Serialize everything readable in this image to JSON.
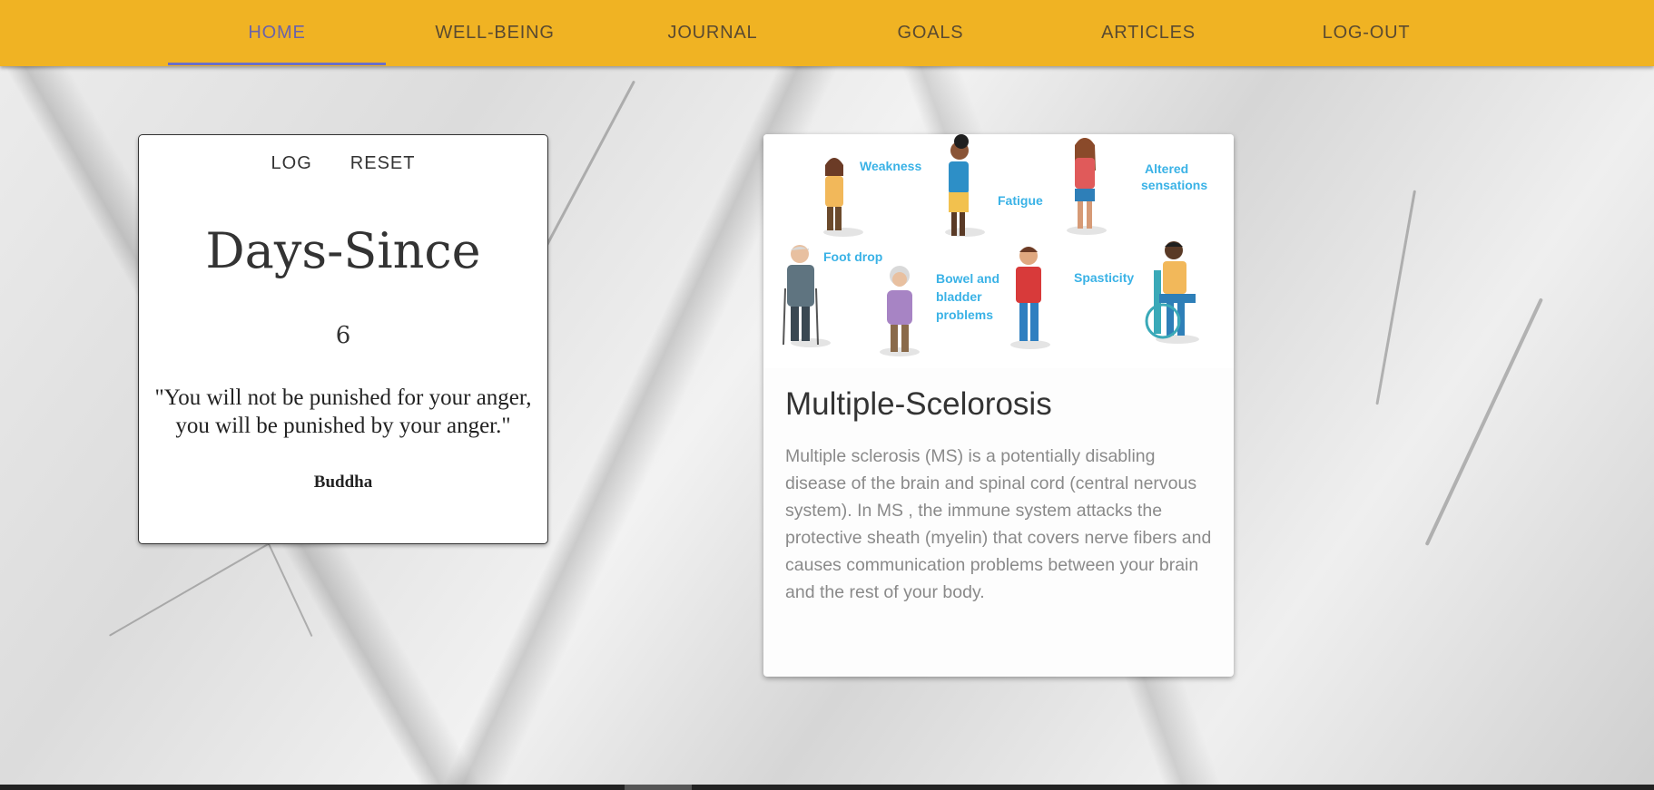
{
  "nav": {
    "tabs": [
      {
        "label": "HOME"
      },
      {
        "label": "WELL-BEING"
      },
      {
        "label": "JOURNAL"
      },
      {
        "label": "GOALS"
      },
      {
        "label": "ARTICLES"
      },
      {
        "label": "LOG-OUT"
      }
    ],
    "active_tab": "HOME",
    "bar_color": "#f0b323",
    "indicator_color": "#6a6fc8"
  },
  "days_card": {
    "log_label": "LOG",
    "reset_label": "RESET",
    "title": "Days-Since",
    "count": "6",
    "quote": "\"You will not be punished for your anger, you will be punished by your anger.\"",
    "author": "Buddha"
  },
  "article": {
    "image_labels": {
      "weakness": "Weakness",
      "fatigue": "Fatigue",
      "altered_1": "Altered",
      "altered_2": "sensations",
      "foot_drop": "Foot drop",
      "bowel_1": "Bowel and",
      "bowel_2": "bladder",
      "bowel_3": "problems",
      "spasticity": "Spasticity"
    },
    "title": "Multiple-Scelorosis",
    "body": "Multiple sclerosis (MS) is a potentially disabling disease of the brain and spinal cord (central nervous system). In MS , the immune system attacks the protective sheath (myelin) that covers nerve fibers and causes communication problems between your brain and the rest of your body."
  }
}
